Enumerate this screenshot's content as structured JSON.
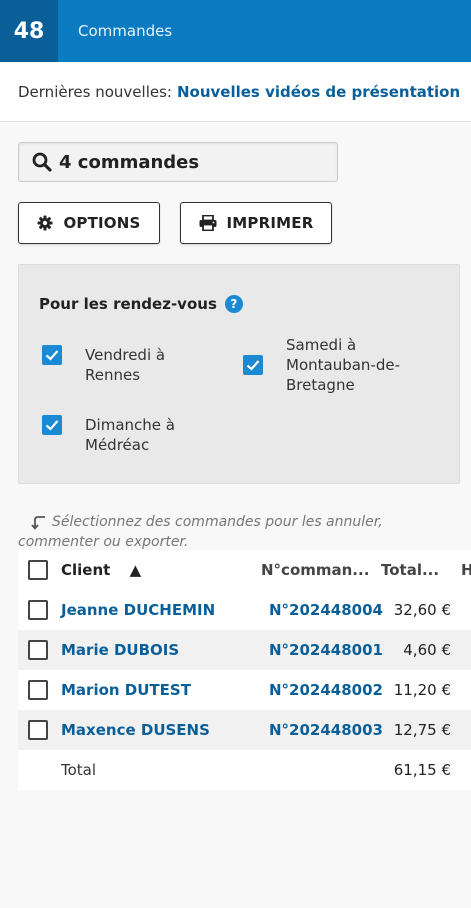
{
  "header": {
    "week_number": "48",
    "title": "Commandes"
  },
  "news": {
    "prefix": "Dernières nouvelles:",
    "link": "Nouvelles vidéos de présentation"
  },
  "search": {
    "value": "4 commandes",
    "icon": "search-icon"
  },
  "buttons": {
    "options": "OPTIONS",
    "print": "IMPRIMER"
  },
  "filters": {
    "title": "Pour les rendez-vous",
    "help": "?",
    "items": [
      {
        "line1": "Vendredi à",
        "line2": "Rennes",
        "line3": "",
        "checked": true
      },
      {
        "line1": "Samedi à",
        "line2": "Montauban-de-",
        "line3": "Bretagne",
        "checked": true
      },
      {
        "line1": "Dimanche à",
        "line2": "Médréac",
        "line3": "",
        "checked": true
      }
    ]
  },
  "hint": {
    "line1": "Sélectionnez des commandes pour les annuler,",
    "line2": "commenter ou exporter."
  },
  "table": {
    "headers": {
      "client": "Client",
      "sort_indicator": "▲",
      "number": "N°comman...",
      "total": "Total...",
      "extra": "H"
    },
    "rows": [
      {
        "client": "Jeanne DUCHEMIN",
        "number": "N°202448004",
        "total": "32,60 €"
      },
      {
        "client": "Marie DUBOIS",
        "number": "N°202448001",
        "total": "4,60 €"
      },
      {
        "client": "Marion DUTEST",
        "number": "N°202448002",
        "total": "11,20 €"
      },
      {
        "client": "Maxence DUSENS",
        "number": "N°202448003",
        "total": "12,75 €"
      }
    ],
    "footer": {
      "label": "Total",
      "amount": "61,15 €"
    }
  },
  "colors": {
    "primary": "#0a7bc1",
    "primary_dark": "#0b5f99",
    "checkbox": "#1a8ad4"
  }
}
